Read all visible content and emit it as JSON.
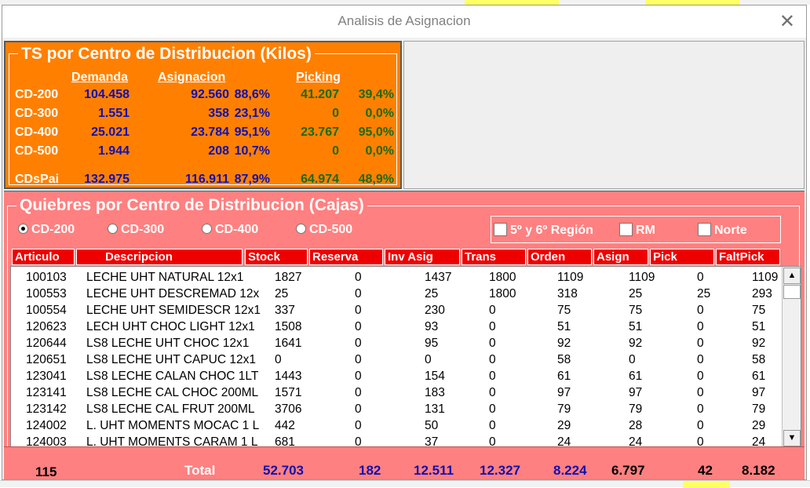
{
  "window": {
    "title": "Analisis de Asignacion"
  },
  "ts": {
    "title": "TS por Centro de Distribucion (Kilos)",
    "headers": {
      "demanda": "Demanda",
      "asignacion": "Asignacion",
      "picking": "Picking"
    },
    "rows": [
      {
        "cd": "CD-200",
        "demanda": "104.458",
        "asig": "92.560",
        "asig_pct": "88,6%",
        "pick": "41.207",
        "pick_pct": "39,4%"
      },
      {
        "cd": "CD-300",
        "demanda": "1.551",
        "asig": "358",
        "asig_pct": "23,1%",
        "pick": "0",
        "pick_pct": "0,0%"
      },
      {
        "cd": "CD-400",
        "demanda": "25.021",
        "asig": "23.784",
        "asig_pct": "95,1%",
        "pick": "23.767",
        "pick_pct": "95,0%"
      },
      {
        "cd": "CD-500",
        "demanda": "1.944",
        "asig": "208",
        "asig_pct": "10,7%",
        "pick": "0",
        "pick_pct": "0,0%"
      },
      {
        "cd": "CDsPai",
        "demanda": "132.975",
        "asig": "116.911",
        "asig_pct": "87,9%",
        "pick": "64.974",
        "pick_pct": "48,9%"
      }
    ]
  },
  "quiebres": {
    "title": "Quiebres por Centro de Distribucion (Cajas)",
    "radios": [
      {
        "label": "CD-200",
        "selected": true
      },
      {
        "label": "CD-300",
        "selected": false
      },
      {
        "label": "CD-400",
        "selected": false
      },
      {
        "label": "CD-500",
        "selected": false
      }
    ],
    "checks": [
      {
        "label": "5º y 6º Región"
      },
      {
        "label": "RM"
      },
      {
        "label": "Norte"
      }
    ],
    "columns": [
      "Articulo",
      "Descripcion",
      "Stock",
      "Reserva",
      "Inv Asig",
      "Trans",
      "Orden",
      "Asign",
      "Pick",
      "FaltPick"
    ],
    "rows": [
      [
        "100103",
        "LECHE UHT NATURAL 12x1",
        "1827",
        "0",
        "1437",
        "1800",
        "1109",
        "1109",
        "0",
        "1109"
      ],
      [
        "100553",
        "LECHE UHT DESCREMAD 12x",
        "25",
        "0",
        "25",
        "1800",
        "318",
        "25",
        "25",
        "293"
      ],
      [
        "100554",
        "LECHE UHT SEMIDESCR 12x1",
        "337",
        "0",
        "230",
        "0",
        "75",
        "75",
        "0",
        "75"
      ],
      [
        "120623",
        "LECH UHT CHOC LIGHT 12x1",
        "1508",
        "0",
        "93",
        "0",
        "51",
        "51",
        "0",
        "51"
      ],
      [
        "120644",
        "LS8 LECHE UHT CHOC 12x1",
        "1641",
        "0",
        "95",
        "0",
        "92",
        "92",
        "0",
        "92"
      ],
      [
        "120651",
        "LS8 LECHE UHT CAPUC 12x1",
        "0",
        "0",
        "0",
        "0",
        "58",
        "0",
        "0",
        "58"
      ],
      [
        "123041",
        "LS8 LECHE CALAN CHOC 1LT",
        "1443",
        "0",
        "154",
        "0",
        "61",
        "61",
        "0",
        "61"
      ],
      [
        "123141",
        "LS8 LECHE CAL CHOC 200ML",
        "1571",
        "0",
        "183",
        "0",
        "97",
        "97",
        "0",
        "97"
      ],
      [
        "123142",
        "LS8 LECHE CAL FRUT 200ML",
        "3706",
        "0",
        "131",
        "0",
        "79",
        "79",
        "0",
        "79"
      ],
      [
        "124002",
        "L. UHT MOMENTS MOCAC 1 L",
        "442",
        "0",
        "50",
        "0",
        "29",
        "28",
        "0",
        "29"
      ],
      [
        "124003",
        "L. UHT MOMENTS CARAM 1 L",
        "681",
        "0",
        "37",
        "0",
        "24",
        "24",
        "0",
        "24"
      ]
    ],
    "totals": {
      "count": "115",
      "label": "Total",
      "stock": "52.703",
      "reserva": "182",
      "inv_asig": "12.511",
      "trans": "12.327",
      "orden": "8.224",
      "asign": "6.797",
      "pick": "42",
      "faltpick": "8.182"
    }
  },
  "colors": {
    "orange_panel": "#ff8000",
    "pink_panel": "#ff8080",
    "header_red": "#ee0000",
    "value_blue": "#1010b0",
    "value_green": "#1a6a1a"
  }
}
